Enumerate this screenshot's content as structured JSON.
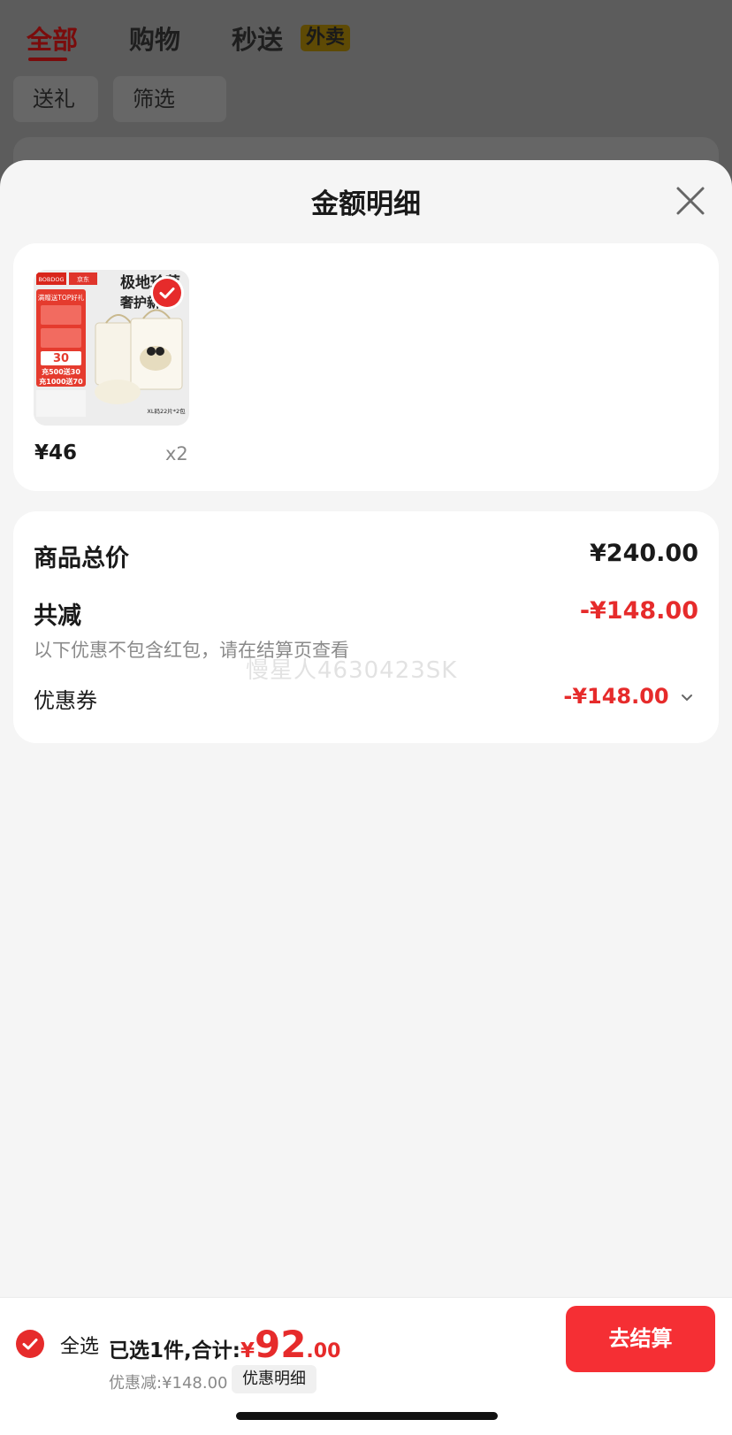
{
  "background": {
    "tabs": [
      "全部",
      "购物",
      "秒送"
    ],
    "badge": "外卖",
    "chips": [
      "送礼",
      "筛选"
    ]
  },
  "sheet": {
    "title": "金额明细",
    "product": {
      "price": "¥46",
      "quantity": "x2",
      "image_text": {
        "brand_left": "BOBDOG",
        "brand_right": "京东",
        "headline_1": "极地珍萃",
        "headline_2": "奢护新生",
        "promo_1": "满赠送TOP好礼",
        "promo_amount": "30",
        "promo_2": "充500送30",
        "promo_3": "充1000送70",
        "size_label": "XL码22片*2包"
      }
    },
    "summary": {
      "total_label": "商品总价",
      "total_value": "¥240.00",
      "reduction_label": "共减",
      "reduction_value": "-¥148.00",
      "note": "以下优惠不包含红包，请在结算页查看",
      "coupon_label": "优惠券",
      "coupon_value": "-¥148.00"
    },
    "watermark": "慢星人4630423SK"
  },
  "bottom_bar": {
    "select_all": "全选",
    "selected_prefix": "已选1件,合计:",
    "currency": "¥",
    "total_int": "92",
    "total_dec": ".00",
    "discount": "优惠减:¥148.00",
    "detail_button": "优惠明细",
    "checkout": "去结算"
  },
  "colors": {
    "accent": "#e62b2b",
    "checkout": "#f52f34",
    "overlay": "#5f5f5f",
    "sheet": "#f5f5f5"
  }
}
